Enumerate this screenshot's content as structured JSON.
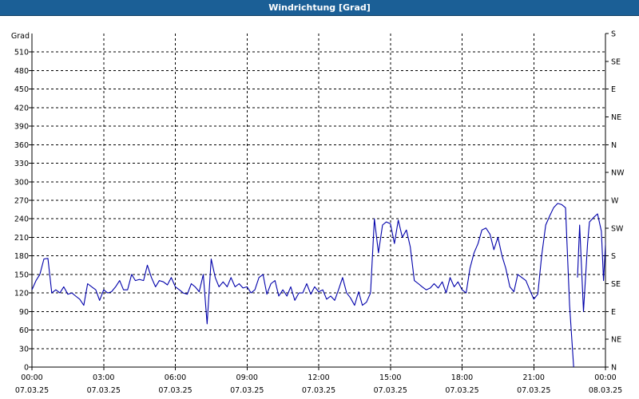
{
  "window": {
    "title": "Windrichtung [Grad]"
  },
  "chart_data": {
    "type": "line",
    "title": "Windrichtung [Grad]",
    "ylabel": "Grad",
    "ylim": [
      0,
      540
    ],
    "yticks": [
      0,
      30,
      60,
      90,
      120,
      150,
      180,
      210,
      240,
      270,
      300,
      330,
      360,
      390,
      420,
      450,
      480,
      510
    ],
    "right_ticks": [
      "N",
      "NE",
      "E",
      "SE",
      "S",
      "SW",
      "W",
      "NW",
      "N",
      "NE",
      "E",
      "SE",
      "S"
    ],
    "xlim_hours": [
      0,
      24
    ],
    "xticks": [
      {
        "time": "00:00",
        "date": "07.03.25"
      },
      {
        "time": "03:00",
        "date": "07.03.25"
      },
      {
        "time": "06:00",
        "date": "07.03.25"
      },
      {
        "time": "09:00",
        "date": "07.03.25"
      },
      {
        "time": "12:00",
        "date": "07.03.25"
      },
      {
        "time": "15:00",
        "date": "07.03.25"
      },
      {
        "time": "18:00",
        "date": "07.03.25"
      },
      {
        "time": "21:00",
        "date": "07.03.25"
      },
      {
        "time": "00:00",
        "date": "08.03.25"
      }
    ],
    "grid": true,
    "line_color": "#0000aa",
    "series": [
      {
        "segments": [
          [
            [
              0.0,
              125
            ],
            [
              0.17,
              140
            ],
            [
              0.33,
              150
            ],
            [
              0.5,
              175
            ],
            [
              0.67,
              176
            ],
            [
              0.83,
              120
            ],
            [
              1.0,
              125
            ],
            [
              1.17,
              120
            ],
            [
              1.33,
              130
            ],
            [
              1.5,
              118
            ],
            [
              1.67,
              120
            ],
            [
              1.83,
              115
            ],
            [
              2.0,
              110
            ],
            [
              2.17,
              100
            ],
            [
              2.33,
              135
            ],
            [
              2.5,
              130
            ],
            [
              2.67,
              125
            ],
            [
              2.83,
              108
            ],
            [
              3.0,
              125
            ],
            [
              3.17,
              120
            ],
            [
              3.33,
              122
            ],
            [
              3.5,
              130
            ],
            [
              3.67,
              140
            ],
            [
              3.83,
              125
            ],
            [
              4.0,
              125
            ],
            [
              4.17,
              150
            ],
            [
              4.33,
              140
            ],
            [
              4.5,
              142
            ],
            [
              4.67,
              140
            ],
            [
              4.83,
              165
            ],
            [
              5.0,
              145
            ],
            [
              5.17,
              130
            ],
            [
              5.33,
              140
            ],
            [
              5.5,
              138
            ],
            [
              5.67,
              133
            ],
            [
              5.83,
              145
            ],
            [
              6.0,
              130
            ],
            [
              6.17,
              125
            ],
            [
              6.33,
              120
            ],
            [
              6.5,
              118
            ],
            [
              6.67,
              135
            ],
            [
              6.83,
              130
            ],
            [
              7.0,
              122
            ],
            [
              7.17,
              150
            ],
            [
              7.33,
              70
            ],
            [
              7.5,
              175
            ],
            [
              7.67,
              145
            ],
            [
              7.83,
              130
            ],
            [
              8.0,
              138
            ],
            [
              8.17,
              130
            ],
            [
              8.33,
              145
            ],
            [
              8.5,
              130
            ],
            [
              8.67,
              135
            ],
            [
              8.83,
              128
            ],
            [
              9.0,
              130
            ],
            [
              9.17,
              120
            ],
            [
              9.33,
              125
            ],
            [
              9.5,
              145
            ],
            [
              9.67,
              150
            ],
            [
              9.83,
              118
            ],
            [
              10.0,
              135
            ],
            [
              10.17,
              140
            ],
            [
              10.33,
              115
            ],
            [
              10.5,
              125
            ],
            [
              10.67,
              115
            ],
            [
              10.83,
              130
            ],
            [
              11.0,
              108
            ],
            [
              11.17,
              120
            ],
            [
              11.33,
              120
            ],
            [
              11.5,
              135
            ],
            [
              11.67,
              118
            ],
            [
              11.83,
              130
            ],
            [
              12.0,
              122
            ],
            [
              12.17,
              125
            ],
            [
              12.33,
              110
            ],
            [
              12.5,
              115
            ],
            [
              12.67,
              108
            ],
            [
              12.83,
              125
            ],
            [
              13.0,
              145
            ],
            [
              13.17,
              120
            ],
            [
              13.33,
              112
            ],
            [
              13.5,
              100
            ],
            [
              13.67,
              122
            ],
            [
              13.83,
              100
            ],
            [
              14.0,
              105
            ],
            [
              14.17,
              120
            ],
            [
              14.33,
              240
            ],
            [
              14.5,
              185
            ],
            [
              14.67,
              230
            ],
            [
              14.83,
              235
            ],
            [
              15.0,
              232
            ],
            [
              15.17,
              200
            ],
            [
              15.33,
              238
            ],
            [
              15.5,
              210
            ],
            [
              15.67,
              222
            ],
            [
              15.83,
              195
            ],
            [
              16.0,
              140
            ],
            [
              16.17,
              135
            ],
            [
              16.33,
              130
            ],
            [
              16.5,
              125
            ],
            [
              16.67,
              128
            ],
            [
              16.83,
              135
            ],
            [
              17.0,
              128
            ],
            [
              17.17,
              138
            ],
            [
              17.33,
              120
            ],
            [
              17.5,
              145
            ],
            [
              17.67,
              130
            ],
            [
              17.83,
              138
            ],
            [
              18.0,
              125
            ],
            [
              18.17,
              120
            ],
            [
              18.33,
              160
            ],
            [
              18.5,
              185
            ],
            [
              18.67,
              200
            ],
            [
              18.83,
              222
            ],
            [
              19.0,
              225
            ],
            [
              19.17,
              215
            ],
            [
              19.33,
              190
            ],
            [
              19.5,
              210
            ],
            [
              19.67,
              180
            ],
            [
              19.83,
              160
            ],
            [
              20.0,
              130
            ],
            [
              20.17,
              122
            ],
            [
              20.33,
              150
            ],
            [
              20.5,
              145
            ],
            [
              20.67,
              140
            ],
            [
              20.83,
              125
            ],
            [
              21.0,
              110
            ],
            [
              21.17,
              118
            ],
            [
              21.33,
              180
            ],
            [
              21.5,
              230
            ],
            [
              21.67,
              245
            ],
            [
              21.83,
              258
            ],
            [
              22.0,
              265
            ],
            [
              22.17,
              263
            ],
            [
              22.33,
              258
            ],
            [
              22.5,
              100
            ],
            [
              22.67,
              0
            ]
          ],
          [
            [
              22.83,
              145
            ],
            [
              22.92,
              230
            ],
            [
              23.08,
              90
            ],
            [
              23.25,
              200
            ],
            [
              23.33,
              235
            ],
            [
              23.5,
              242
            ],
            [
              23.67,
              248
            ],
            [
              23.83,
              220
            ],
            [
              23.92,
              140
            ],
            [
              24.08,
              255
            ],
            [
              24.25,
              105
            ]
          ]
        ]
      }
    ]
  }
}
